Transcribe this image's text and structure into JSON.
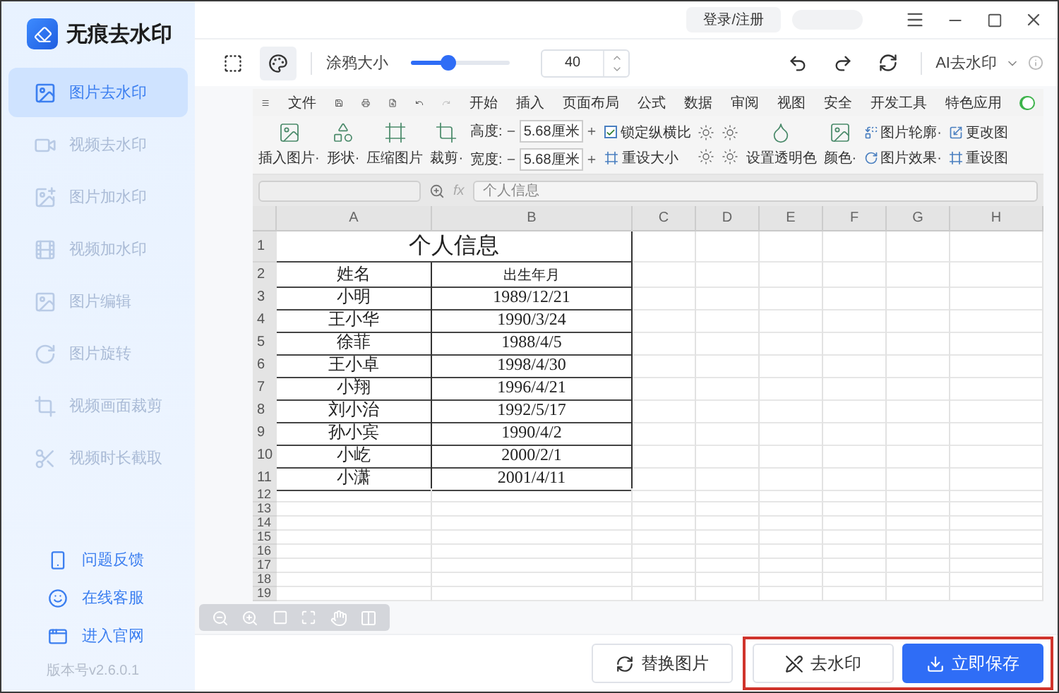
{
  "app": {
    "title": "无痕去水印",
    "version": "版本号v2.6.0.1"
  },
  "nav": [
    {
      "label": "图片去水印",
      "selected": true
    },
    {
      "label": "视频去水印",
      "selected": false
    },
    {
      "label": "图片加水印",
      "selected": false
    },
    {
      "label": "视频加水印",
      "selected": false
    },
    {
      "label": "图片编辑",
      "selected": false
    },
    {
      "label": "图片旋转",
      "selected": false
    },
    {
      "label": "视频画面裁剪",
      "selected": false
    },
    {
      "label": "视频时长截取",
      "selected": false
    }
  ],
  "footer_links": [
    {
      "label": "问题反馈"
    },
    {
      "label": "在线客服"
    },
    {
      "label": "进入官网"
    }
  ],
  "topbar": {
    "login": "登录/注册"
  },
  "toolbar": {
    "tools": [
      {
        "selected": false
      },
      {
        "selected": true
      }
    ],
    "brush": {
      "label": "涂鸦大小",
      "level": 0.37,
      "value": "40"
    },
    "ai_mode": "AI去水印"
  },
  "sheet": {
    "menu": [
      "文件",
      "开始",
      "插入",
      "页面布局",
      "公式",
      "数据",
      "审阅",
      "视图",
      "安全",
      "开发工具",
      "特色应用"
    ],
    "ribbon": [
      {
        "kind": "big",
        "label": "插入图片·"
      },
      {
        "kind": "big",
        "label": "形状·"
      },
      {
        "kind": "big",
        "label": "压缩图片"
      },
      {
        "kind": "big",
        "label": "裁剪·"
      },
      {
        "kind": "fields",
        "items": [
          {
            "label": "高度:",
            "value": "5.68厘米"
          },
          {
            "label": "宽度:",
            "value": "5.68厘米"
          }
        ]
      },
      {
        "kind": "stack",
        "items": [
          {
            "kind": "check",
            "label": "锁定纵横比",
            "checked": true
          },
          {
            "kind": "tool",
            "label": "重设大小"
          }
        ]
      },
      {
        "kind": "adjust"
      },
      {
        "kind": "big",
        "label": "设置透明色"
      },
      {
        "kind": "big",
        "label": "颜色·"
      },
      {
        "kind": "stack",
        "items": [
          {
            "kind": "tool",
            "label": "图片轮廓·"
          },
          {
            "kind": "tool",
            "label": "图片效果·"
          }
        ]
      },
      {
        "kind": "stack",
        "items": [
          {
            "kind": "tool",
            "label": "更改图"
          },
          {
            "kind": "tool",
            "label": "重设图"
          }
        ]
      }
    ],
    "fx_label": "fx",
    "toggle": {
      "on": true
    },
    "formula": "个人信息",
    "columns": [
      "A",
      "B",
      "C",
      "D",
      "E",
      "F",
      "G",
      "H"
    ],
    "title_row": {
      "number": "1",
      "text": "个人信息"
    },
    "rows": [
      {
        "number": "2",
        "name": "姓名",
        "date": "出生年月"
      },
      {
        "number": "3",
        "name": "小明",
        "date": "1989/12/21"
      },
      {
        "number": "4",
        "name": "王小华",
        "date": "1990/3/24"
      },
      {
        "number": "5",
        "name": "徐菲",
        "date": "1988/4/5"
      },
      {
        "number": "6",
        "name": "王小卓",
        "date": "1998/4/30"
      },
      {
        "number": "7",
        "name": "小翔",
        "date": "1996/4/21"
      },
      {
        "number": "8",
        "name": "刘小治",
        "date": "1992/5/17"
      },
      {
        "number": "9",
        "name": "孙小宾",
        "date": "1990/4/2"
      },
      {
        "number": "10",
        "name": "小屹",
        "date": "2000/2/1"
      },
      {
        "number": "11",
        "name": "小潇",
        "date": "2001/4/11"
      }
    ],
    "empty_rows": [
      "12",
      "13",
      "14",
      "15",
      "16",
      "17",
      "18",
      "19"
    ]
  },
  "actions": {
    "replace": "替换图片",
    "remove": "去水印",
    "save": "立即保存"
  }
}
